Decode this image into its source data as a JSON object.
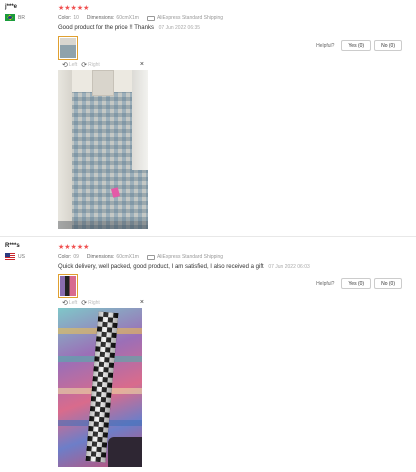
{
  "reviews": [
    {
      "user": "j***e",
      "country": "BR",
      "stars": "★★★★★",
      "color_label": "Color:",
      "color_value": "10",
      "dimensions_label": "Dimensions:",
      "dimensions_value": "60cmX1m",
      "shipping": "AliExpress Standard Shipping",
      "text": "Good product for the price !! Thanks",
      "date": "07 Jun 2022 06:35",
      "helpful_label": "Helpful?",
      "yes_label": "Yes (0)",
      "no_label": "No (0)",
      "viewer_left": "Left",
      "viewer_right": "Right",
      "viewer_close": "×"
    },
    {
      "user": "R***s",
      "country": "US",
      "stars": "★★★★★",
      "color_label": "Color:",
      "color_value": "09",
      "dimensions_label": "Dimensions:",
      "dimensions_value": "60cmX1m",
      "shipping": "AliExpress Standard Shipping",
      "text": "Quick delivery, well packed, good product, I am satisfied, I also received a gift",
      "date": "07 Jun 2022 06:03",
      "helpful_label": "Helpful?",
      "yes_label": "Yes (0)",
      "no_label": "No (0)",
      "viewer_left": "Left",
      "viewer_right": "Right",
      "viewer_close": "×"
    }
  ],
  "icons": {
    "rotate_left": "⟲",
    "rotate_right": "⟳"
  }
}
